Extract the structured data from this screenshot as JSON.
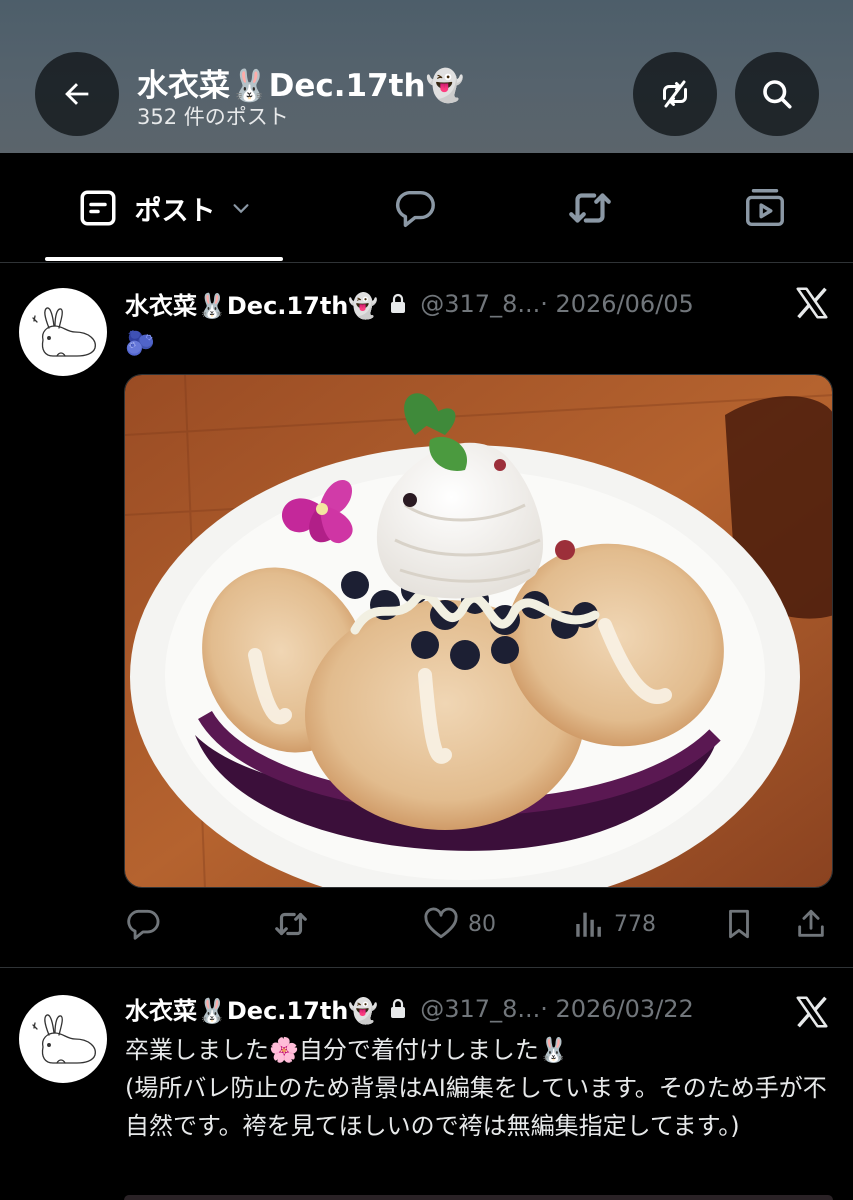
{
  "header": {
    "title": "水衣菜🐰Dec.17th👻",
    "post_count": "352 件のポスト",
    "back_icon": "arrow-left-icon",
    "norepost_icon": "repost-off-icon",
    "search_icon": "search-icon"
  },
  "tabs": [
    {
      "label": "ポスト",
      "icon": "post-icon",
      "active": true
    },
    {
      "label": "",
      "icon": "replies-icon",
      "active": false
    },
    {
      "label": "",
      "icon": "repost-icon",
      "active": false
    },
    {
      "label": "",
      "icon": "media-icon",
      "active": false
    }
  ],
  "tweets": [
    {
      "name": "水衣菜🐰Dec.17th👻",
      "handle": "@317_8...",
      "date": "· 2026/06/05",
      "text": "🫐",
      "reply_count": "",
      "repost_count": "",
      "like_count": "80",
      "views_count": "778"
    },
    {
      "name": "水衣菜🐰Dec.17th👻",
      "handle": "@317_8...",
      "date": "· 2026/03/22",
      "text": "卒業しました🌸自分で着付けしました🐰\n(場所バレ防止のため背景はAI編集をしています。そのため手が不自然です。袴を見てほしいので袴は無編集指定してます。)"
    }
  ],
  "colors": {
    "accent_text": "#e7e9ea",
    "muted": "#71767b",
    "divider": "#2f3336",
    "background": "#000000"
  }
}
